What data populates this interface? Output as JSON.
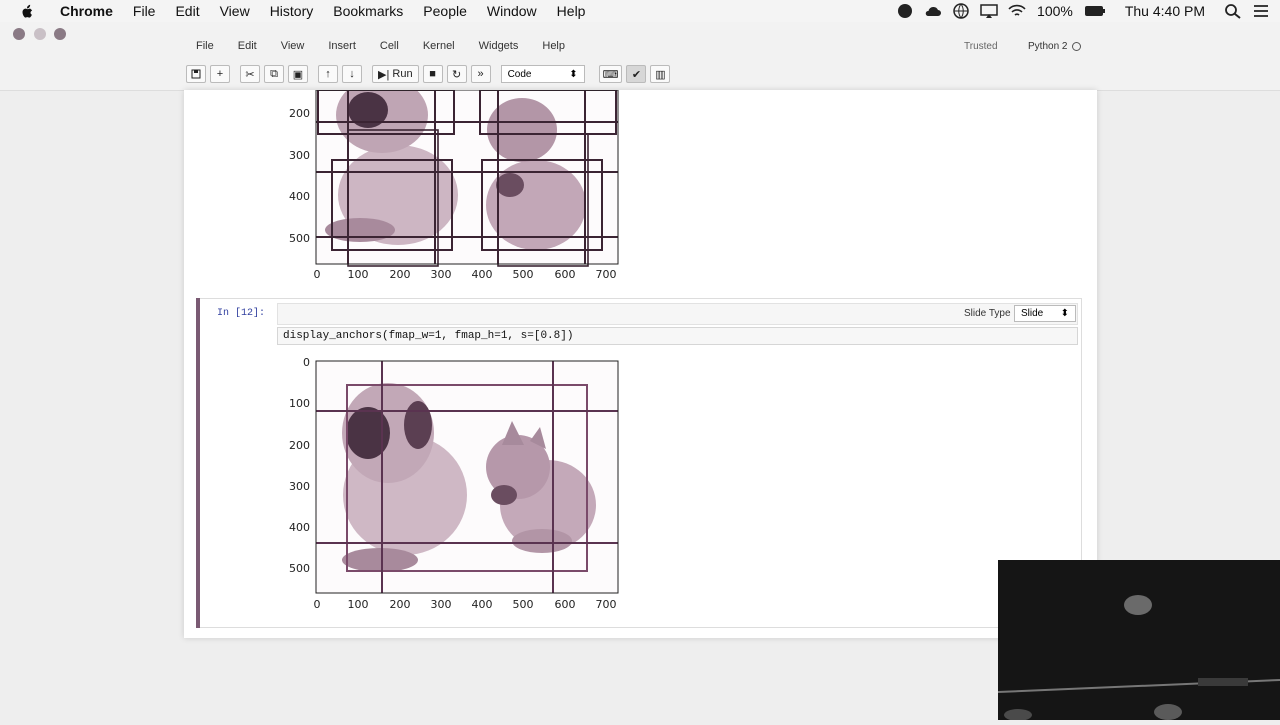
{
  "menubar": {
    "app": "Chrome",
    "items": [
      "File",
      "Edit",
      "View",
      "History",
      "Bookmarks",
      "People",
      "Window",
      "Help"
    ],
    "battery": "100%",
    "clock": "Thu 4:40 PM"
  },
  "jupyter": {
    "menu": [
      "File",
      "Edit",
      "View",
      "Insert",
      "Cell",
      "Kernel",
      "Widgets",
      "Help"
    ],
    "trusted": "Trusted",
    "kernel": "Python 2",
    "toolbar": {
      "run_label": "Run",
      "cell_type": "Code"
    }
  },
  "cell": {
    "prompt": "In [12]:",
    "slide_type_label": "Slide Type",
    "slide_type_value": "Slide",
    "code": "display_anchors(fmap_w=1, fmap_h=1, s=[0.8])"
  },
  "plots": {
    "top": {
      "y_ticks": [
        "200",
        "300",
        "400",
        "500"
      ],
      "x_ticks": [
        "0",
        "100",
        "200",
        "300",
        "400",
        "500",
        "600",
        "700"
      ]
    },
    "bottom": {
      "y_ticks": [
        "0",
        "100",
        "200",
        "300",
        "400",
        "500"
      ],
      "x_ticks": [
        "0",
        "100",
        "200",
        "300",
        "400",
        "500",
        "600",
        "700"
      ]
    }
  }
}
